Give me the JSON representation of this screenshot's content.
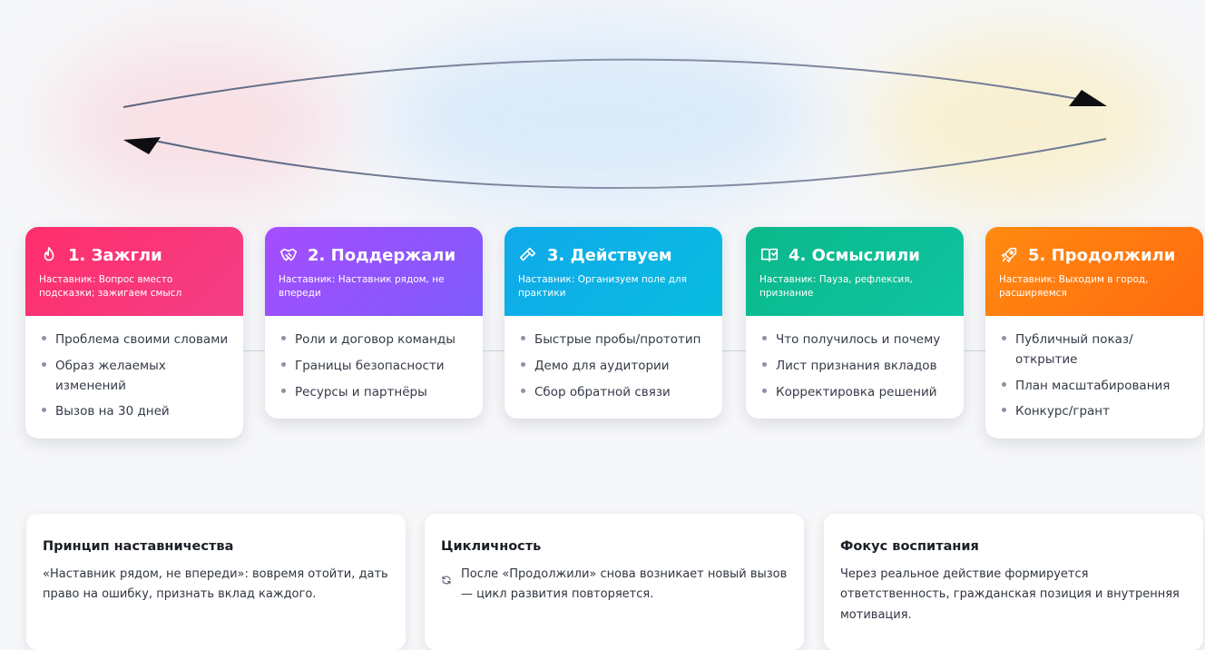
{
  "colors": {
    "stage1": [
      "#ff2e6c",
      "#f43f86"
    ],
    "stage2": [
      "#a64dff",
      "#7e5bfa"
    ],
    "stage3": [
      "#10a8ea",
      "#08bde0"
    ],
    "stage4": [
      "#0bb88a",
      "#0fc4a1"
    ],
    "stage5": [
      "#ff8a10",
      "#ff6b10"
    ],
    "arc": "#6b7690"
  },
  "stages": [
    {
      "icon": "flame-icon",
      "title": "1. Зажгли",
      "subtitle": "Наставник: Вопрос вместо подсказки; зажигаем смысл",
      "items": [
        "Проблема своими словами",
        "Образ желаемых изменений",
        "Вызов на 30 дней"
      ]
    },
    {
      "icon": "handshake-icon",
      "title": "2. Поддержали",
      "subtitle": "Наставник: Наставник рядом, не впереди",
      "items": [
        "Роли и договор команды",
        "Границы безопасности",
        "Ресурсы и партнёры"
      ]
    },
    {
      "icon": "hammer-icon",
      "title": "3. Действуем",
      "subtitle": "Наставник: Организуем поле для практики",
      "items": [
        "Быстрые пробы/прототип",
        "Демо для аудитории",
        "Сбор обратной связи"
      ]
    },
    {
      "icon": "book-icon",
      "title": "4. Осмыслили",
      "subtitle": "Наставник: Пауза, рефлексия, признание",
      "items": [
        "Что получилось и почему",
        "Лист признания вкладов",
        "Корректировка решений"
      ]
    },
    {
      "icon": "rocket-icon",
      "title": "5. Продолжили",
      "subtitle": "Наставник: Выходим в город, расширяемся",
      "items": [
        "Публичный показ/открытие",
        "План масштабирования",
        "Конкурс/грант"
      ]
    }
  ],
  "info": [
    {
      "title": "Принцип наставничества",
      "text": "«Наставник рядом, не впереди»: вовремя отойти, дать право на ошибку, признать вклад каждого."
    },
    {
      "title": "Цикличность",
      "text": "После «Продолжили» снова возникает новый вызов — цикл развития повторяется.",
      "icon": "refresh-icon"
    },
    {
      "title": "Фокус воспитания",
      "text": "Через реальное действие формируется ответственность, гражданская позиция и внутренняя мотивация."
    }
  ]
}
